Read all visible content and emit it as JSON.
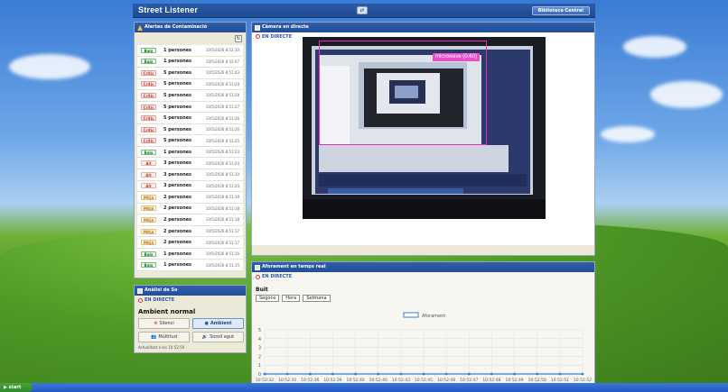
{
  "app": {
    "title": "Street Listener",
    "library_button": "Biblioteca Central"
  },
  "alerts": {
    "title": "Alertes de Contaminació",
    "rows": [
      {
        "level": "Baix",
        "count": "1 persones",
        "time": "10/5/2026 8:52:10",
        "class": "b-baix"
      },
      {
        "level": "Baix",
        "count": "1 persones",
        "time": "10/5/2026 8:52:07",
        "class": "b-baix"
      },
      {
        "level": "Crític",
        "count": "5 persones",
        "time": "10/5/2026 8:51:43",
        "class": "b-critic"
      },
      {
        "level": "Crític",
        "count": "5 persones",
        "time": "10/5/2026 8:51:29",
        "class": "b-critic"
      },
      {
        "level": "Crític",
        "count": "5 persones",
        "time": "10/5/2026 8:51:28",
        "class": "b-critic"
      },
      {
        "level": "Crític",
        "count": "5 persones",
        "time": "10/5/2026 8:51:27",
        "class": "b-critic"
      },
      {
        "level": "Crític",
        "count": "5 persones",
        "time": "10/5/2026 8:51:26",
        "class": "b-critic"
      },
      {
        "level": "Crític",
        "count": "5 persones",
        "time": "10/5/2026 8:51:26",
        "class": "b-critic"
      },
      {
        "level": "Crític",
        "count": "5 persones",
        "time": "10/5/2026 8:51:25",
        "class": "b-critic"
      },
      {
        "level": "Baix",
        "count": "1 persones",
        "time": "10/5/2026 8:51:24",
        "class": "b-baix"
      },
      {
        "level": "Alt",
        "count": "3 persones",
        "time": "10/5/2026 8:51:24",
        "class": "b-alt"
      },
      {
        "level": "Alt",
        "count": "3 persones",
        "time": "10/5/2026 8:51:20",
        "class": "b-alt"
      },
      {
        "level": "Alt",
        "count": "3 persones",
        "time": "10/5/2026 8:51:20",
        "class": "b-alt"
      },
      {
        "level": "Mitjà",
        "count": "2 persones",
        "time": "10/5/2026 8:51:19",
        "class": "b-mitja"
      },
      {
        "level": "Mitjà",
        "count": "2 persones",
        "time": "10/5/2026 8:51:18",
        "class": "b-mitja"
      },
      {
        "level": "Mitjà",
        "count": "2 persones",
        "time": "10/5/2026 8:51:18",
        "class": "b-mitja"
      },
      {
        "level": "Mitjà",
        "count": "2 persones",
        "time": "10/5/2026 8:51:17",
        "class": "b-mitja"
      },
      {
        "level": "Mitjà",
        "count": "2 persones",
        "time": "10/5/2026 8:51:17",
        "class": "b-mitja"
      },
      {
        "level": "Baix",
        "count": "1 persones",
        "time": "10/5/2026 8:51:16",
        "class": "b-baix"
      },
      {
        "level": "Baix",
        "count": "1 persones",
        "time": "10/5/2026 8:51:15",
        "class": "b-baix"
      }
    ]
  },
  "sound": {
    "title": "Anàlisi de So",
    "live": "EN DIRECTE",
    "status": "Ambient normal",
    "buttons": {
      "silence": "Silenci",
      "ambient": "Ambient",
      "crowd": "Multitud",
      "sharp": "Soroll agut"
    },
    "updated": "Actualitzat a les 10:52:50"
  },
  "camera": {
    "title": "Càmera en directe",
    "live": "EN DIRECTE",
    "detection_label": "microwave (0.60)"
  },
  "capacity": {
    "title": "Aforament en temps real",
    "live": "EN DIRECTE",
    "status": "Buit",
    "ranges": [
      "Segons",
      "Hora",
      "Setmana"
    ]
  },
  "taskbar": {
    "start": "start"
  },
  "chart_data": {
    "type": "line",
    "legend": "Aforament",
    "x": [
      "10:52:32",
      "10:52:35",
      "10:52:36",
      "10:52:39",
      "10:52:40",
      "10:52:40",
      "10:52:43",
      "10:52:45",
      "10:52:46",
      "10:52:47",
      "10:52:48",
      "10:52:49",
      "10:52:50",
      "10:52:51",
      "10:52:52"
    ],
    "series": [
      {
        "name": "Aforament",
        "values": [
          0,
          0,
          0,
          0,
          0,
          0,
          0,
          0,
          0,
          0,
          0,
          0,
          0,
          0,
          0
        ]
      }
    ],
    "yticks": [
      0,
      1,
      2,
      3,
      4,
      5
    ],
    "ylim": [
      0,
      5
    ],
    "grid": true,
    "legend_position": "top-center"
  }
}
